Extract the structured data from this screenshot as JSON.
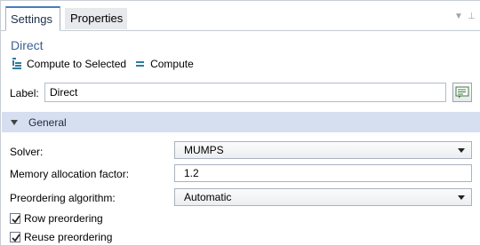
{
  "tabs": [
    {
      "label": "Settings"
    },
    {
      "label": "Properties"
    }
  ],
  "node": {
    "title": "Direct"
  },
  "toolbar": {
    "compute_selected_label": "Compute to Selected",
    "compute_label": "Compute"
  },
  "label_field": {
    "caption": "Label:",
    "value": "Direct"
  },
  "section": {
    "title": "General"
  },
  "form": {
    "solver": {
      "label": "Solver:",
      "value": "MUMPS"
    },
    "memory": {
      "label": "Memory allocation factor:",
      "value": "1.2"
    },
    "preordering": {
      "label": "Preordering algorithm:",
      "value": "Automatic"
    },
    "row_preordering": {
      "label": "Row preordering",
      "checked": true
    },
    "reuse_preordering": {
      "label": "Reuse preordering",
      "checked": true
    }
  },
  "colors": {
    "title_blue": "#3c6197",
    "section_bg": "#d5dfef",
    "tab_accent": "#4a7bbd"
  },
  "icons": {
    "compute_selected": "compute-to-selected-icon",
    "compute": "compute-icon",
    "label_button": "label-edit-icon",
    "tab_menu": "chevron-down-icon",
    "tab_pin": "pin-icon"
  }
}
